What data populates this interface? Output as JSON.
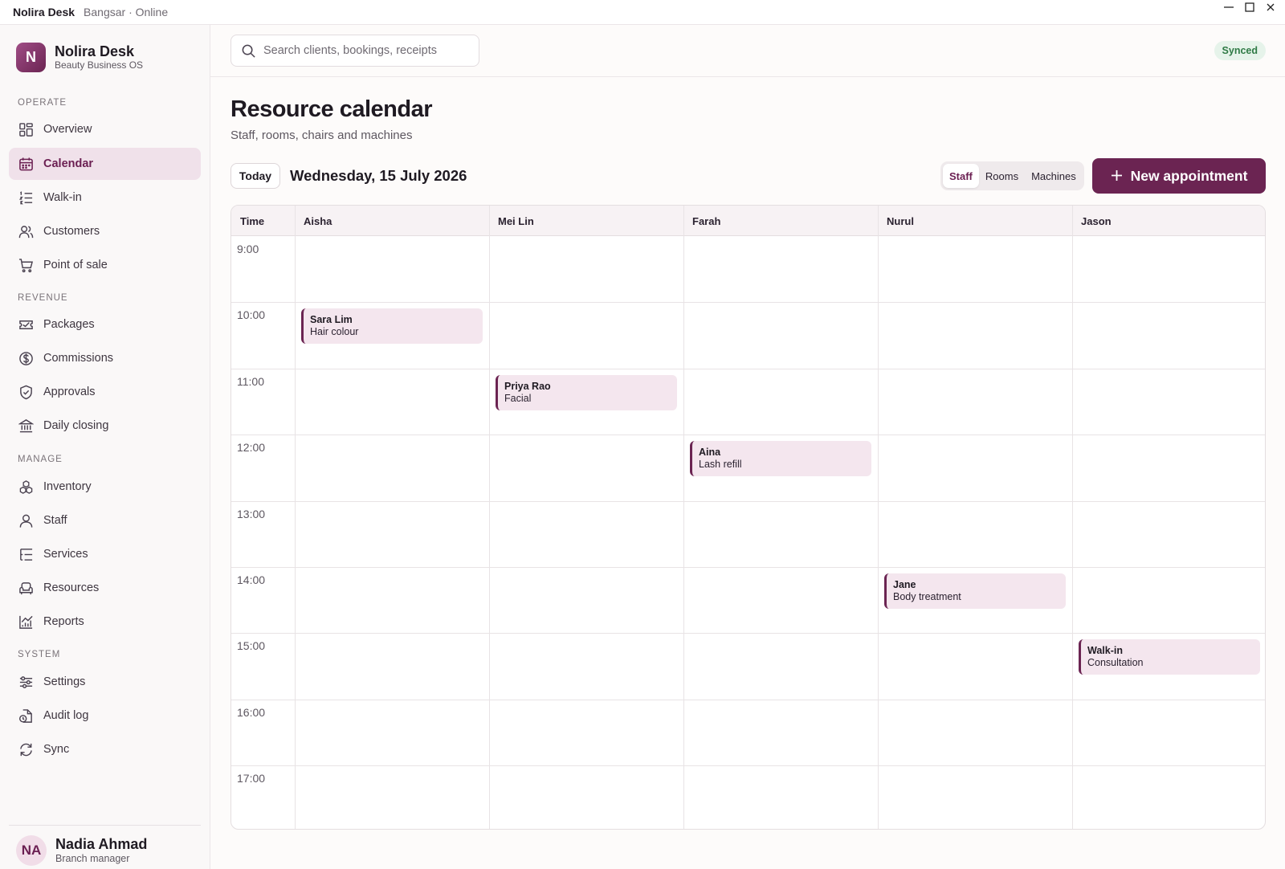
{
  "window": {
    "app_name": "Nolira Desk",
    "location": "Bangsar · Online"
  },
  "brand": {
    "logo_letter": "N",
    "name": "Nolira Desk",
    "tagline": "Beauty Business OS"
  },
  "sidebar": {
    "sections": [
      {
        "title": "OPERATE",
        "items": [
          {
            "label": "Overview",
            "icon": "grid-icon"
          },
          {
            "label": "Calendar",
            "icon": "calendar-icon",
            "active": true
          },
          {
            "label": "Walk-in",
            "icon": "list-icon"
          },
          {
            "label": "Customers",
            "icon": "users-icon"
          },
          {
            "label": "Point of sale",
            "icon": "cart-icon"
          }
        ]
      },
      {
        "title": "REVENUE",
        "items": [
          {
            "label": "Packages",
            "icon": "ticket-icon"
          },
          {
            "label": "Commissions",
            "icon": "dollar-icon"
          },
          {
            "label": "Approvals",
            "icon": "shield-check-icon"
          },
          {
            "label": "Daily closing",
            "icon": "bank-icon"
          }
        ]
      },
      {
        "title": "MANAGE",
        "items": [
          {
            "label": "Inventory",
            "icon": "boxes-icon"
          },
          {
            "label": "Staff",
            "icon": "user-icon"
          },
          {
            "label": "Services",
            "icon": "list-tree-icon"
          },
          {
            "label": "Resources",
            "icon": "armchair-icon"
          },
          {
            "label": "Reports",
            "icon": "chart-icon"
          }
        ]
      },
      {
        "title": "SYSTEM",
        "items": [
          {
            "label": "Settings",
            "icon": "sliders-icon"
          },
          {
            "label": "Audit log",
            "icon": "file-clock-icon"
          },
          {
            "label": "Sync",
            "icon": "refresh-icon"
          }
        ]
      }
    ]
  },
  "profile": {
    "initials": "NA",
    "name": "Nadia Ahmad",
    "role": "Branch manager"
  },
  "topbar": {
    "search_placeholder": "Search clients, bookings, receipts",
    "sync_status": "Synced"
  },
  "page": {
    "title": "Resource calendar",
    "subtitle": "Staff, rooms, chairs and machines"
  },
  "toolbar": {
    "today_label": "Today",
    "date": "Wednesday, 15 July 2026",
    "views": [
      "Staff",
      "Rooms",
      "Machines"
    ],
    "selected_view": "Staff",
    "new_label": "New appointment"
  },
  "calendar": {
    "time_header": "Time",
    "resources": [
      "Aisha",
      "Mei Lin",
      "Farah",
      "Nurul",
      "Jason"
    ],
    "hours": [
      "9:00",
      "10:00",
      "11:00",
      "12:00",
      "13:00",
      "14:00",
      "15:00",
      "16:00",
      "17:00"
    ],
    "appointments": [
      {
        "resource": 0,
        "hour": 1,
        "client": "Sara Lim",
        "service": "Hair colour"
      },
      {
        "resource": 1,
        "hour": 2,
        "client": "Priya Rao",
        "service": "Facial"
      },
      {
        "resource": 2,
        "hour": 3,
        "client": "Aina",
        "service": "Lash refill"
      },
      {
        "resource": 3,
        "hour": 5,
        "client": "Jane",
        "service": "Body treatment"
      },
      {
        "resource": 4,
        "hour": 6,
        "client": "Walk-in",
        "service": "Consultation"
      }
    ]
  },
  "colors": {
    "accent": "#6b2452",
    "accent_soft": "#f0e1ea",
    "appointment_bg": "#f4e6ee",
    "synced_green": "#2f7a45"
  }
}
